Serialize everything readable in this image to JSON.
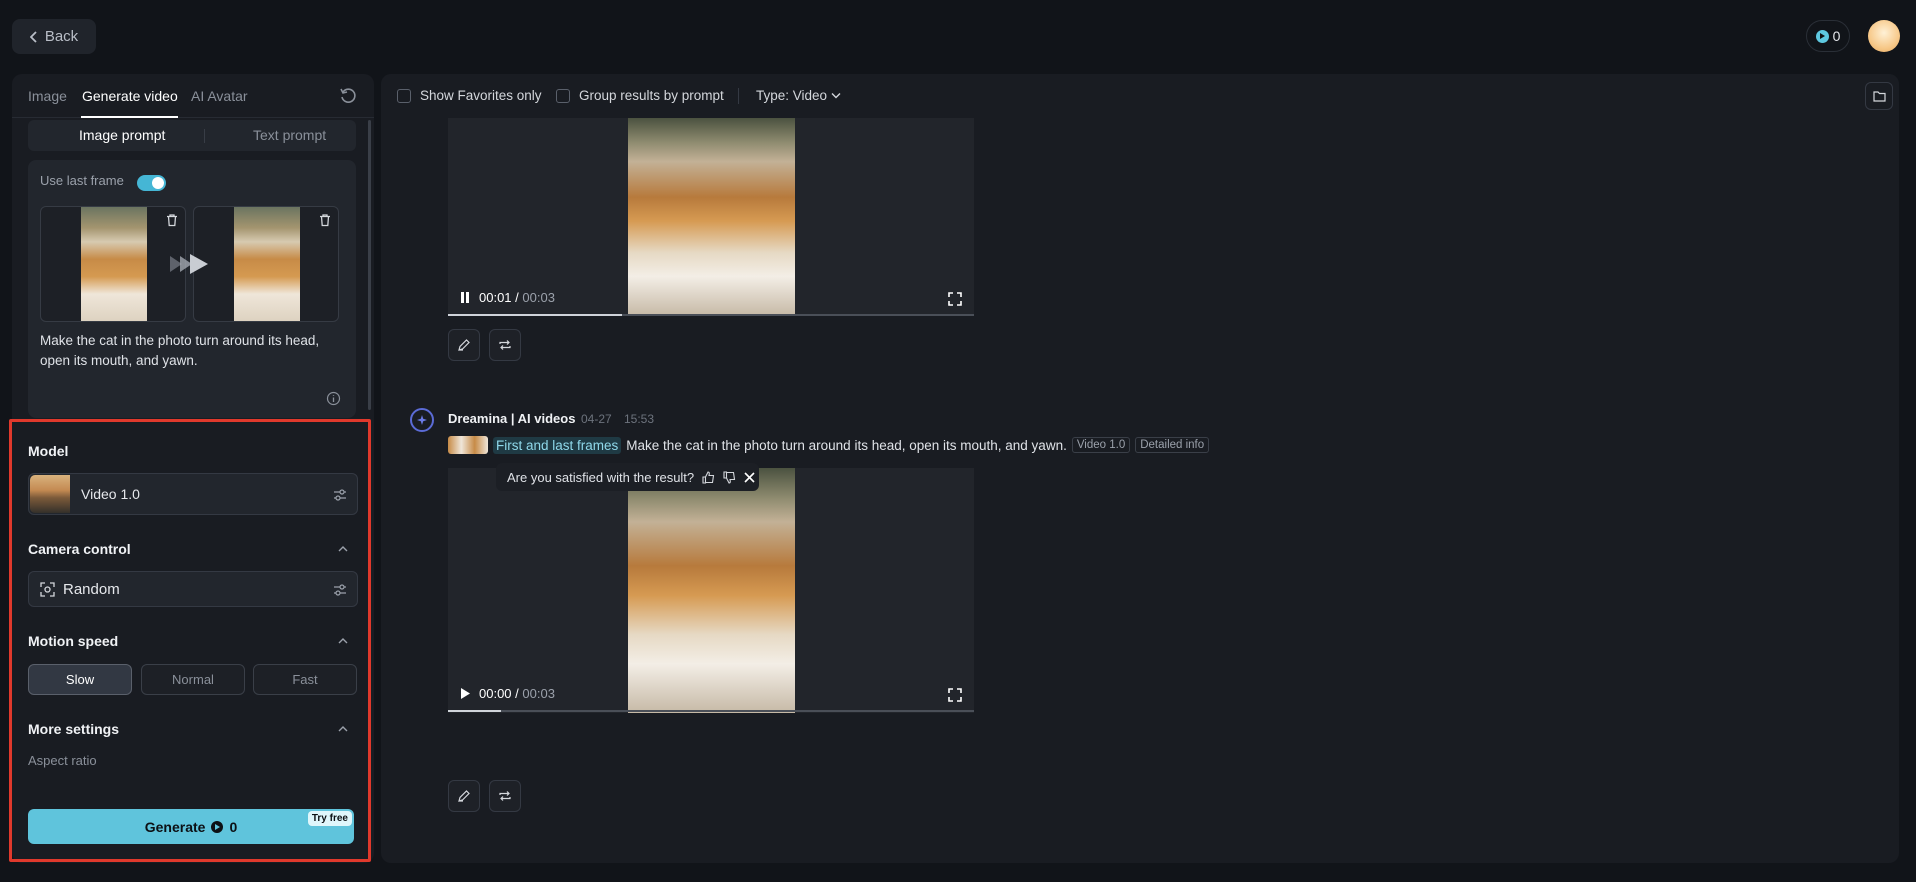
{
  "topbar": {
    "back_label": "Back",
    "credits": "0"
  },
  "left": {
    "tabs": [
      "Image",
      "Generate video",
      "AI Avatar"
    ],
    "subtabs": [
      "Image prompt",
      "Text prompt"
    ],
    "use_last_frame_label": "Use last frame",
    "use_last_frame_on": true,
    "prompt_text": "Make the cat in the photo turn around its head, open its mouth, and yawn.",
    "model_title": "Model",
    "model_name": "Video 1.0",
    "camera_title": "Camera control",
    "camera_value": "Random",
    "motion_title": "Motion speed",
    "speeds": [
      "Slow",
      "Normal",
      "Fast"
    ],
    "speed_selected": "Slow",
    "more_title": "More settings",
    "aspect_label": "Aspect ratio",
    "generate_label": "Generate",
    "generate_cost": "0",
    "try_free": "Try free"
  },
  "main": {
    "filters": {
      "favorites": "Show Favorites only",
      "group": "Group results by prompt",
      "type": "Type: Video"
    },
    "video1": {
      "current": "00:01",
      "sep": "/",
      "total": "00:03",
      "progress": 0.33
    },
    "entry": {
      "author": "Dreamina | AI videos",
      "date": "04-27",
      "time": "15:53",
      "frames_chip": "First and last frames",
      "prompt": "Make the cat in the photo turn around its head, open its mouth, and yawn.",
      "model_tag": "Video 1.0",
      "detail_tag": "Detailed info"
    },
    "feedback_text": "Are you satisfied with the result?",
    "video2": {
      "current": "00:00",
      "sep": "/",
      "total": "00:03",
      "progress": 0.1
    }
  },
  "colors": {
    "accent": "#5fc4dc",
    "highlight_border": "#e0392c",
    "panel": "#191c22",
    "background": "#111419"
  }
}
